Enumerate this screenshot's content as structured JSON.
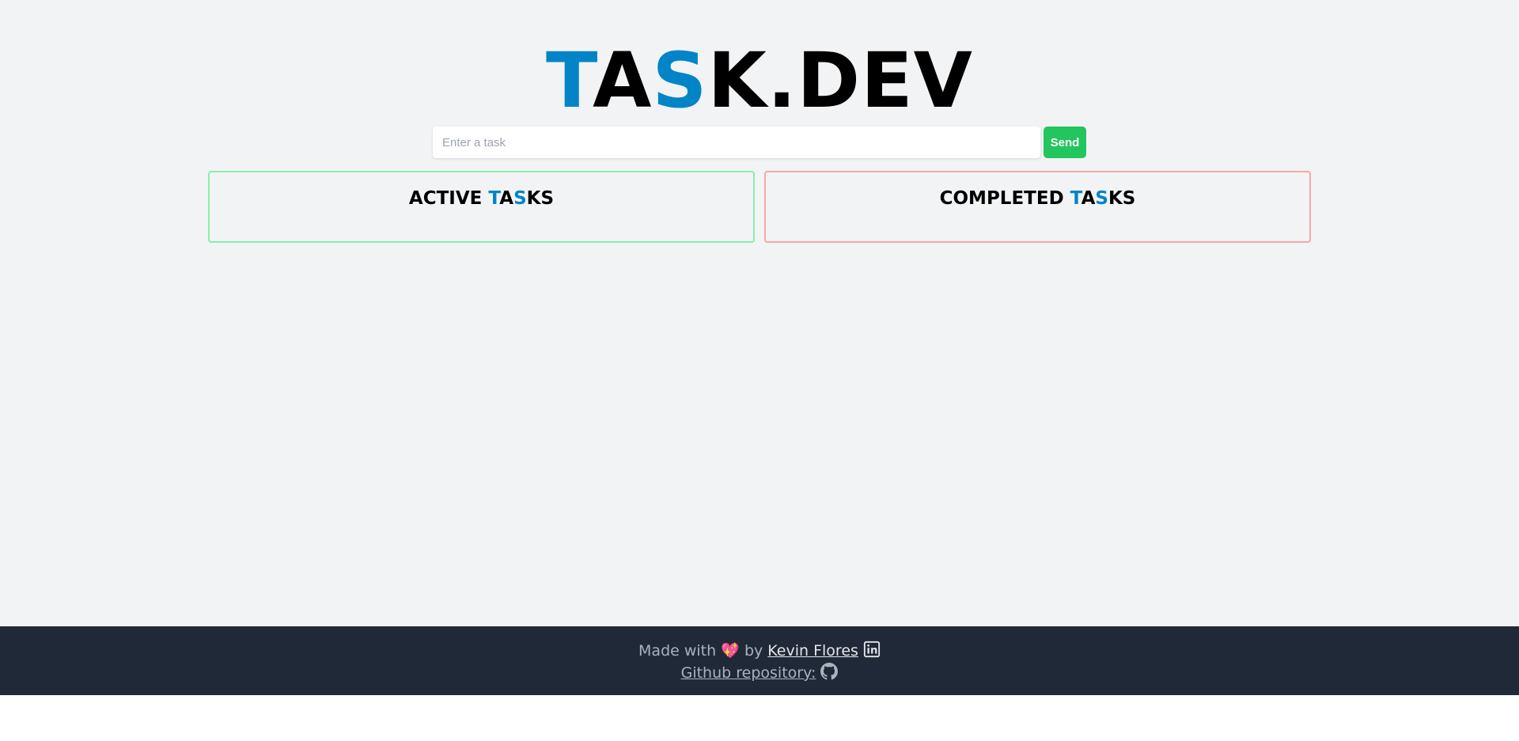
{
  "logo": {
    "part1": "T",
    "part2": "A",
    "part3": "S",
    "part4": "K.DEV"
  },
  "task_form": {
    "placeholder": "Enter a task",
    "send_label": "Send"
  },
  "active_panel": {
    "title_prefix": "ACTIVE ",
    "t": "T",
    "a": "A",
    "s": "S",
    "rest": "KS"
  },
  "completed_panel": {
    "title_prefix": "COMPLETED ",
    "t": "T",
    "a": "A",
    "s": "S",
    "rest": "KS"
  },
  "footer": {
    "made_with": "Made with",
    "heart": "💖",
    "by": "by",
    "author": "Kevin Flores",
    "repo_label": "Github repository:"
  },
  "icons": {
    "linkedin": "linkedin-icon",
    "github": "github-icon",
    "heart": "heart-icon"
  },
  "colors": {
    "accent": "#0284c7",
    "send": "#22c55e",
    "active_border": "#86efac",
    "completed_border": "#fca5a5",
    "footer_bg": "#1f2937"
  }
}
